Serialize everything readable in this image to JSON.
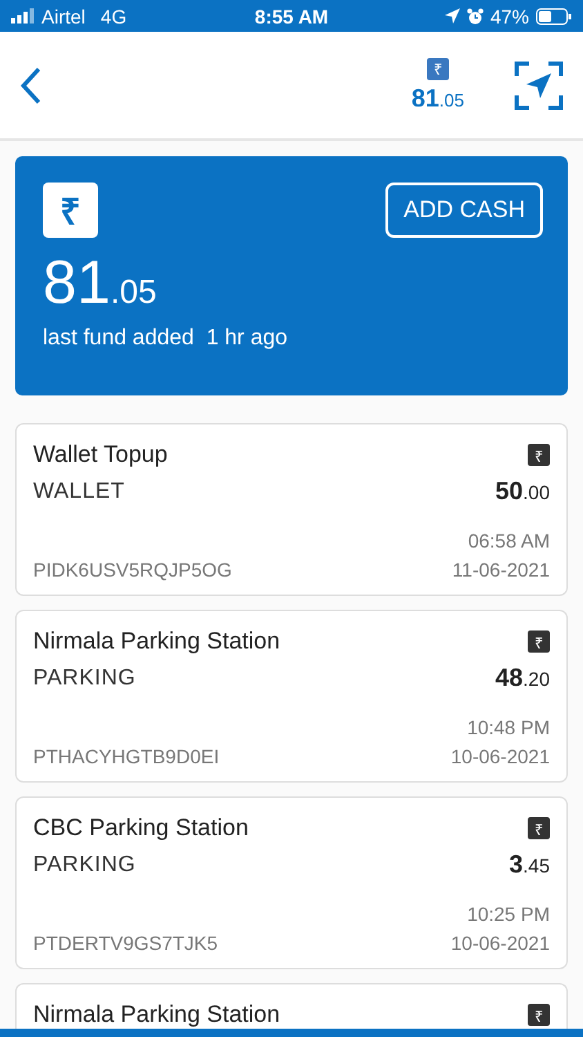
{
  "status_bar": {
    "carrier": "Airtel",
    "network": "4G",
    "time": "8:55 AM",
    "battery": "47%"
  },
  "header": {
    "currency": "₹",
    "balance_int": "81",
    "balance_dec": ".05"
  },
  "wallet": {
    "currency": "₹",
    "button": "ADD CASH",
    "balance_int": "81",
    "balance_dec": ".05",
    "note": "last fund added  1 hr ago"
  },
  "transactions": [
    {
      "title": "Wallet Topup",
      "category": "WALLET",
      "currency": "₹",
      "amount_int": "50",
      "amount_dec": ".00",
      "time": "06:58 AM",
      "id": "PIDK6USV5RQJP5OG",
      "date": "11-06-2021"
    },
    {
      "title": "Nirmala Parking Station",
      "category": "PARKING",
      "currency": "₹",
      "amount_int": "48",
      "amount_dec": ".20",
      "time": "10:48 PM",
      "id": "PTHACYHGTB9D0EI",
      "date": "10-06-2021"
    },
    {
      "title": "CBC Parking Station",
      "category": "PARKING",
      "currency": "₹",
      "amount_int": "3",
      "amount_dec": ".45",
      "time": "10:25 PM",
      "id": "PTDERTV9GS7TJK5",
      "date": "10-06-2021"
    },
    {
      "title": "Nirmala Parking Station",
      "currency": "₹"
    }
  ]
}
